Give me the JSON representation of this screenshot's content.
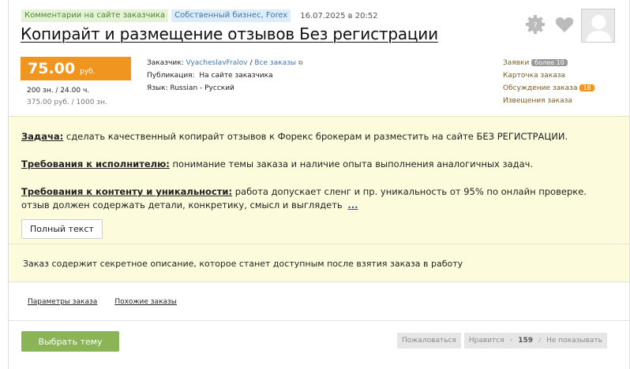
{
  "header": {
    "tags": [
      "Комментарии на сайте заказчика",
      "Собственный бизнес, Forex"
    ],
    "date": "16.07.2025 в 20:52",
    "title": "Копирайт и размещение отзывов Без регистрации"
  },
  "price": {
    "amount": "75.00",
    "currency": "руб.",
    "line1": "200 зн. / 24.00 ч.",
    "line2": "375.00 руб. / 1000 зн."
  },
  "meta": {
    "customer_label": "Заказчик:",
    "customer_name": "VyacheslavFralov",
    "all_orders": "Все заказы",
    "publication_label": "Публикация:",
    "publication_value": "На сайте заказчика",
    "language_label": "Язык:",
    "language_value": "Russian - Русский"
  },
  "side": {
    "requests": "Заявки",
    "requests_badge": "более 10",
    "order_card": "Карточка заказа",
    "discussion": "Обсуждение заказа",
    "discussion_badge": "18",
    "notifications": "Извещения заказа"
  },
  "task": {
    "task_label": "Задача:",
    "task_text": "сделать качественный копирайт отзывов к Форекс брокерам и разместить на сайте БЕЗ РЕГИСТРАЦИИ.",
    "req_label": "Требования к исполнителю:",
    "req_text": "понимание темы заказа и наличие опыта выполнения аналогичных задач.",
    "content_label": "Требования к контенту и уникальности:",
    "content_text": "работа допускает сленг и пр. уникальность от 95% по онлайн проверке.",
    "content_text2": "отзыв должен содержать детали, конкретику, смысл и выглядеть",
    "more": "...",
    "full_text_button": "Полный текст"
  },
  "secret_note": "Заказ содержит секретное описание, которое станет доступным после взятия заказа в работу",
  "bottom_links": {
    "params": "Параметры заказа",
    "similar": "Похожие заказы"
  },
  "actions": {
    "choose": "Выбрать тему",
    "complain": "Пожаловаться",
    "like": "Нравится",
    "like_count": "159",
    "hide": "Не показывать"
  },
  "icons": [
    "question-gear-icon",
    "heart-icon",
    "avatar"
  ],
  "colors": {
    "accent_orange": "#f0961e",
    "choose_green": "#8ab456",
    "task_bg": "#fcfcdc"
  }
}
